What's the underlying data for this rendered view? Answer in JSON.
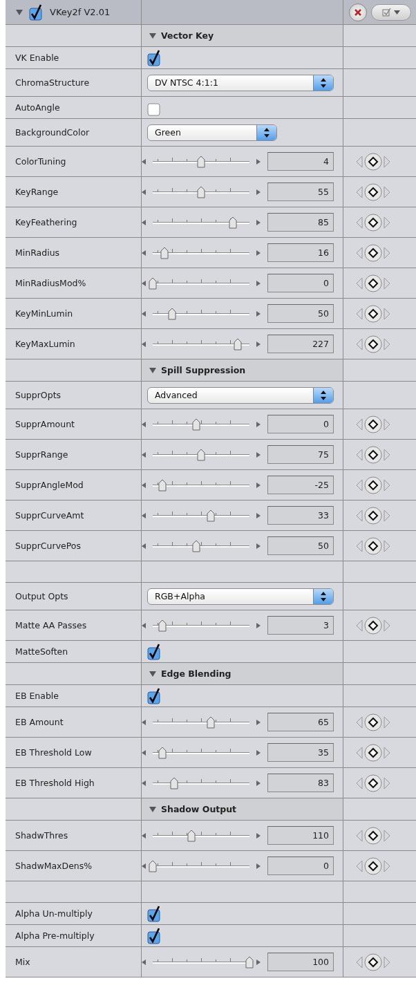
{
  "header": {
    "title": "VKey2f V2.01",
    "expanded": true,
    "enabled": true
  },
  "rows": [
    {
      "kind": "section",
      "title": "Vector Key",
      "expanded": true
    },
    {
      "kind": "checkbox",
      "label": "VK Enable",
      "checked": true
    },
    {
      "kind": "dropdown",
      "label": "ChromaStructure",
      "value": "DV NTSC 4:1:1",
      "wide": true
    },
    {
      "kind": "checkbox",
      "label": "AutoAngle",
      "checked": false
    },
    {
      "kind": "dropdown",
      "label": "BackgroundColor",
      "value": "Green",
      "wide": false
    },
    {
      "kind": "slider",
      "label": "ColorTuning",
      "level": 0.5,
      "value": "4"
    },
    {
      "kind": "slider",
      "label": "KeyRange",
      "level": 0.5,
      "value": "55"
    },
    {
      "kind": "slider",
      "label": "KeyFeathering",
      "level": 0.83,
      "value": "85"
    },
    {
      "kind": "slider",
      "label": "MinRadius",
      "level": 0.12,
      "value": "16"
    },
    {
      "kind": "slider",
      "label": "MinRadiusMod%",
      "level": 0,
      "value": "0"
    },
    {
      "kind": "slider",
      "label": "KeyMinLumin",
      "level": 0.2,
      "value": "50"
    },
    {
      "kind": "slider",
      "label": "KeyMaxLumin",
      "level": 0.88,
      "value": "227"
    },
    {
      "kind": "section",
      "title": "Spill Suppression",
      "expanded": true
    },
    {
      "kind": "dropdown",
      "label": "SupprOpts",
      "value": "Advanced",
      "wide": true
    },
    {
      "kind": "slider",
      "label": "SupprAmount",
      "level": 0.45,
      "value": "0"
    },
    {
      "kind": "slider",
      "label": "SupprRange",
      "level": 0.5,
      "value": "75"
    },
    {
      "kind": "slider",
      "label": "SupprAngleMod",
      "level": 0.1,
      "value": "-25"
    },
    {
      "kind": "slider",
      "label": "SupprCurveAmt",
      "level": 0.6,
      "value": "33"
    },
    {
      "kind": "slider",
      "label": "SupprCurvePos",
      "level": 0.45,
      "value": "50"
    },
    {
      "kind": "blank"
    },
    {
      "kind": "dropdown",
      "label": "Output Opts",
      "value": "RGB+Alpha",
      "wide": true
    },
    {
      "kind": "slider",
      "label": "Matte AA Passes",
      "level": 0.1,
      "value": "3"
    },
    {
      "kind": "checkbox",
      "label": "MatteSoften",
      "checked": true
    },
    {
      "kind": "section",
      "title": "Edge Blending",
      "expanded": true
    },
    {
      "kind": "checkbox",
      "label": "EB Enable",
      "checked": true
    },
    {
      "kind": "slider",
      "label": "EB Amount",
      "level": 0.6,
      "value": "65"
    },
    {
      "kind": "slider",
      "label": "EB Threshold Low",
      "level": 0.1,
      "value": "35"
    },
    {
      "kind": "slider",
      "label": "EB Threshold High",
      "level": 0.22,
      "value": "83"
    },
    {
      "kind": "section",
      "title": "Shadow Output",
      "expanded": true
    },
    {
      "kind": "slider",
      "label": "ShadwThres",
      "level": 0.4,
      "value": "110"
    },
    {
      "kind": "slider",
      "label": "ShadwMaxDens%",
      "level": 0,
      "value": "0"
    },
    {
      "kind": "blank"
    },
    {
      "kind": "checkbox",
      "label": "Alpha Un-multiply",
      "checked": true
    },
    {
      "kind": "checkbox",
      "label": "Alpha Pre-multiply",
      "checked": true
    },
    {
      "kind": "slider",
      "label": "Mix",
      "level": 1,
      "value": "100"
    }
  ]
}
